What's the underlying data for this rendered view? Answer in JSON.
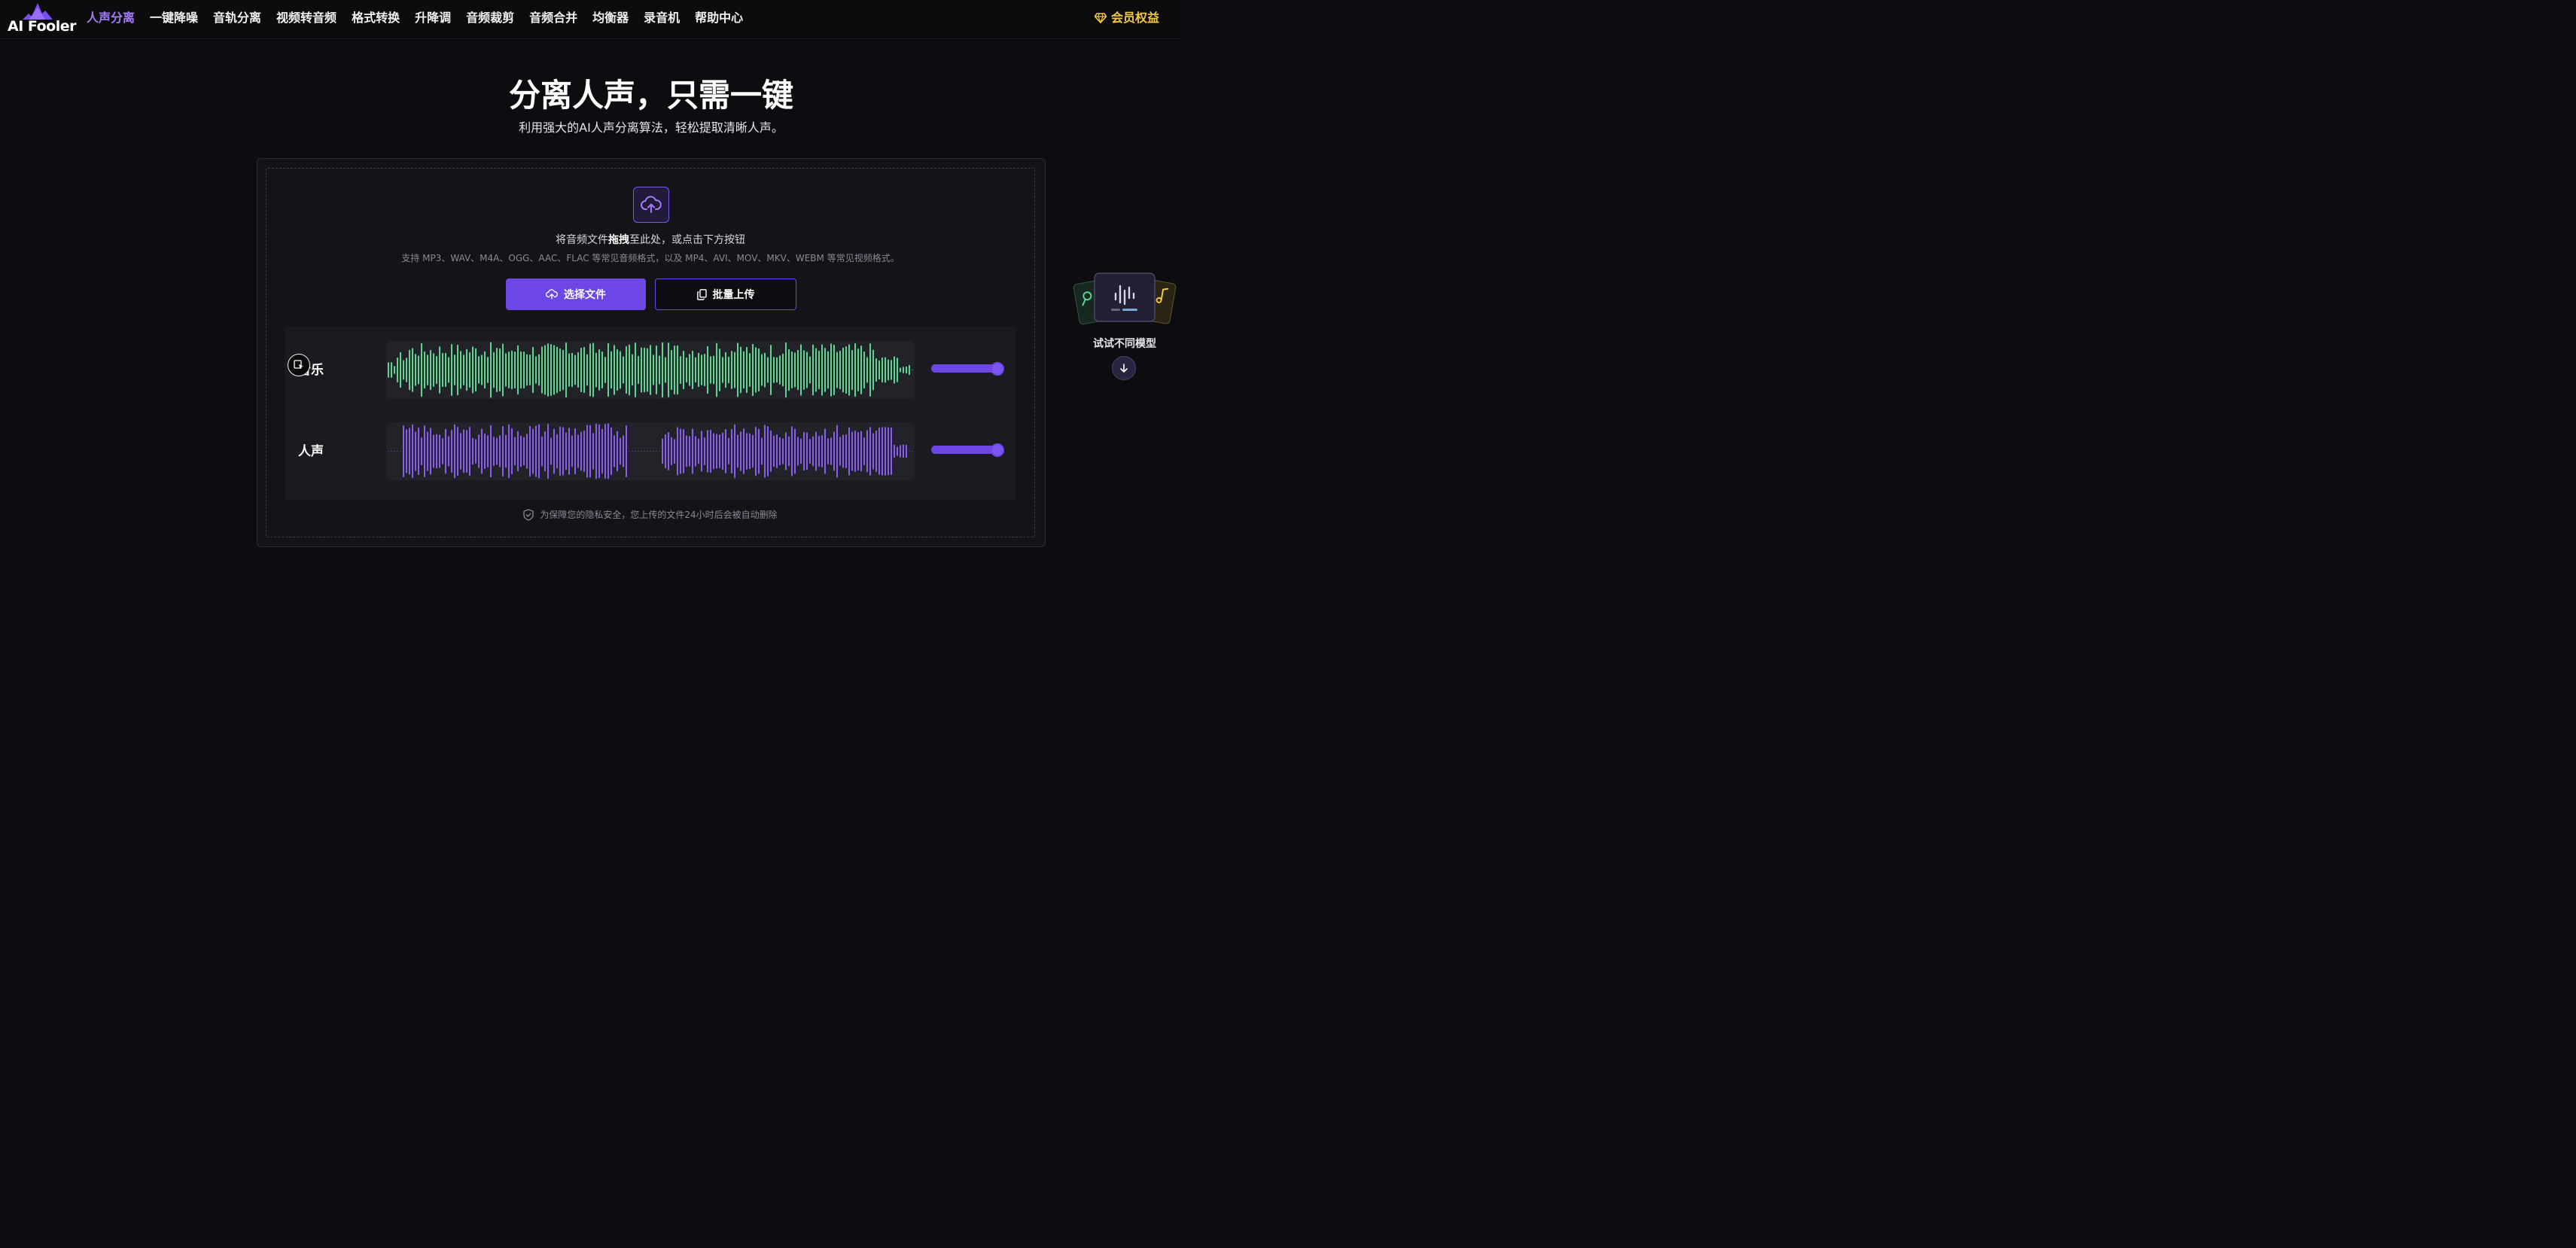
{
  "brand": {
    "name": "AI Fooler",
    "logo_color": "#7b4cf0"
  },
  "nav": {
    "items": [
      {
        "label": "人声分离",
        "active": true
      },
      {
        "label": "一键降噪"
      },
      {
        "label": "音轨分离"
      },
      {
        "label": "视频转音频"
      },
      {
        "label": "格式转换"
      },
      {
        "label": "升降调"
      },
      {
        "label": "音频裁剪"
      },
      {
        "label": "音频合并"
      },
      {
        "label": "均衡器"
      },
      {
        "label": "录音机"
      },
      {
        "label": "帮助中心"
      }
    ],
    "vip_label": "会员权益",
    "vip_icon": "diamond-icon",
    "vip_color": "#f5c842"
  },
  "hero": {
    "title": "分离人声，只需一键",
    "subtitle": "利用强大的AI人声分离算法，轻松提取清晰人声。"
  },
  "upload": {
    "icon": "cloud-upload-icon",
    "drop_text_pre": "将音频文件",
    "drop_text_bold": "拖拽",
    "drop_text_post": "至此处，或点击下方按钮",
    "formats": "支持 MP3、WAV、M4A、OGG、AAC、FLAC 等常见音频格式，以及 MP4、AVI、MOV、MKV、WEBM 等常见视频格式。",
    "select_button": "选择文件",
    "batch_button": "批量上传",
    "accent": "#6c47e6"
  },
  "demo": {
    "tracks": [
      {
        "label": "音乐",
        "color": "#5fd491",
        "volume": 1.0
      },
      {
        "label": "人声",
        "color": "#8a5cf0",
        "volume": 1.0
      }
    ]
  },
  "privacy": {
    "icon": "shield-check-icon",
    "text": "为保障您的隐私安全，您上传的文件24小时后会被自动删除"
  },
  "models": {
    "label": "试试不同模型",
    "icon": "waveform-icon",
    "arrow_icon": "arrow-down-icon"
  }
}
